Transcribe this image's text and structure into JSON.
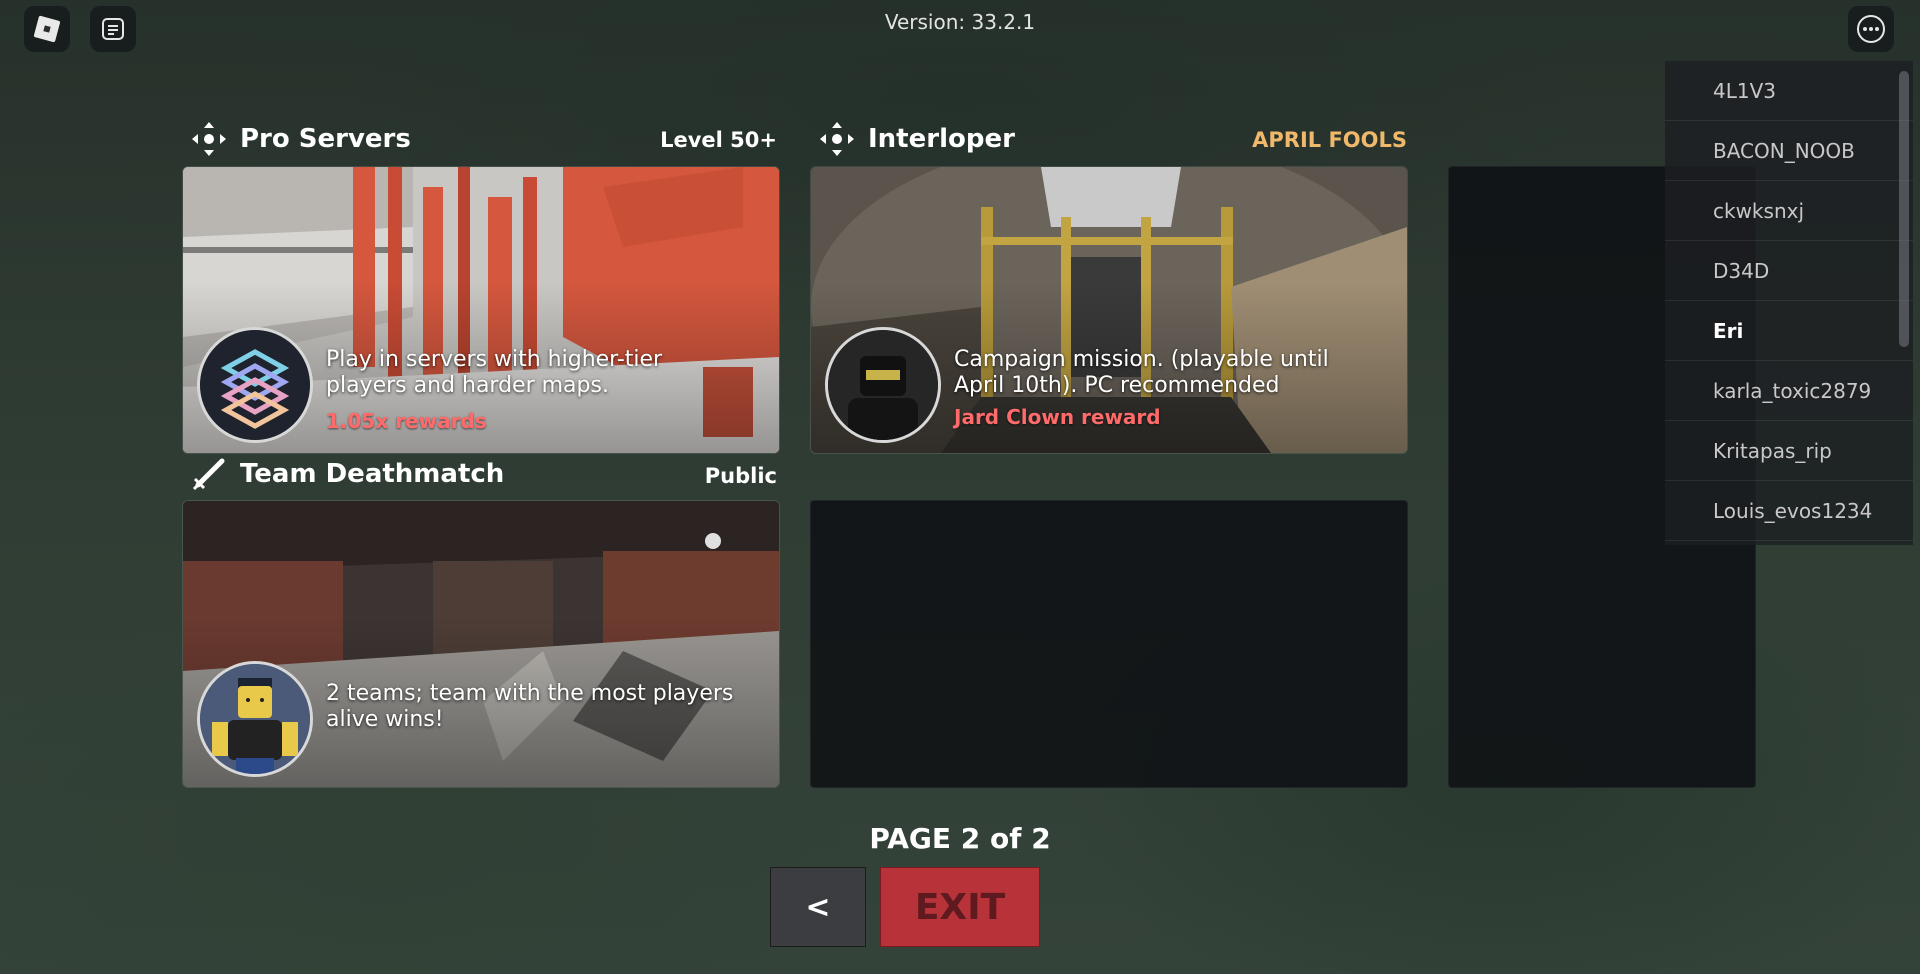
{
  "header": {
    "version": "Version: 33.2.1",
    "logo_icon": "roblox-logo-icon",
    "chat_icon": "chat-icon",
    "menu_icon": "more-options-icon"
  },
  "cards": [
    {
      "title": "Pro Servers",
      "tag": "Level 50+",
      "icon": "move-arrows-icon",
      "description": "Play in servers with higher-tier players and harder maps.",
      "reward": "1.05x rewards"
    },
    {
      "title": "Interloper",
      "tag": "APRIL FOOLS",
      "tag_color": "#f0b86a",
      "icon": "move-arrows-icon",
      "description": "Campaign mission. (playable until April 10th). PC recommended",
      "reward": "Jard Clown reward"
    },
    {
      "title": "Team Deathmatch",
      "tag": "Public",
      "icon": "sword-icon",
      "description": "2 teams; team with the most players alive wins!",
      "reward": ""
    }
  ],
  "pagination": {
    "label": "PAGE 2 of 2",
    "prev_label": "<",
    "exit_label": "EXIT"
  },
  "players": [
    "4L1V3",
    "BACON_NOOB",
    "ckwksnxj",
    "D34D",
    "Eri",
    "karla_toxic2879",
    "Kritapas_rip",
    "Louis_evos1234"
  ],
  "colors": {
    "reward": "#ff6b6b",
    "exit_button": "#b8323a",
    "april_fools": "#f0b86a"
  }
}
